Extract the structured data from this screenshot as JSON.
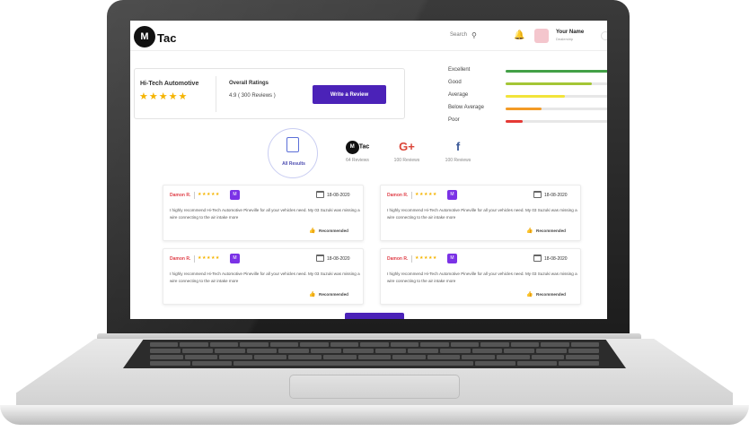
{
  "header": {
    "logo_mark": "M",
    "logo_text": "Tac",
    "search_label": "Search",
    "user_name": "Your Name",
    "user_role": "Dealership"
  },
  "summary": {
    "business_name": "Hi-Tech Automotive",
    "stars": "★★★★★",
    "overall_label": "Overall Ratings",
    "overall_value": "4.9 ( 300 Reviews )",
    "write_review_label": "Write a Review"
  },
  "rating_breakdown": [
    {
      "label": "Excellent",
      "fraction": 0.95,
      "color": "#43a047"
    },
    {
      "label": "Good",
      "fraction": 0.8,
      "color": "#a4c635"
    },
    {
      "label": "Average",
      "fraction": 0.55,
      "color": "#f2e43a"
    },
    {
      "label": "Below Average",
      "fraction": 0.33,
      "color": "#f39a26"
    },
    {
      "label": "Poor",
      "fraction": 0.16,
      "color": "#e53935"
    }
  ],
  "sources": [
    {
      "name": "All Results",
      "count": ""
    },
    {
      "name": "MTac",
      "icon": "mtac-logo-icon",
      "count": "64 Reviews"
    },
    {
      "name": "Google",
      "icon": "google-plus-icon",
      "glyph": "G+",
      "color": "#db4437",
      "count": "100 Reviews"
    },
    {
      "name": "Facebook",
      "icon": "facebook-icon",
      "glyph": "f",
      "color": "#3b5998",
      "count": "100 Reviews"
    }
  ],
  "reviews": [
    {
      "name": "Damon R.",
      "stars": "★★★★★",
      "badge": "M",
      "date": "18-08-2020",
      "text": "I highly recommend Hi-Tech Automotive Pineville for all your vehicles need. My 03 Suzuki was missing a wire connecting to the air intake more",
      "recommended": "Recommended"
    },
    {
      "name": "Damon R.",
      "stars": "★★★★★",
      "badge": "M",
      "date": "18-08-2020",
      "text": "I highly recommend Hi-Tech Automotive Pineville for all your vehicles need. My 03 Suzuki was missing a wire connecting to the air intake more",
      "recommended": "Recommended"
    },
    {
      "name": "Damon R.",
      "stars": "★★★★★",
      "badge": "M",
      "date": "18-08-2020",
      "text": "I highly recommend Hi-Tech Automotive Pineville for all your vehicles need. My 03 Suzuki was missing a wire connecting to the air intake more",
      "recommended": "Recommended"
    },
    {
      "name": "Damon R.",
      "stars": "★★★★★",
      "badge": "M",
      "date": "18-08-2020",
      "text": "I highly recommend Hi-Tech Automotive Pineville for all your vehicles need. My 03 Suzuki was missing a wire connecting to the air intake more",
      "recommended": "Recommended"
    }
  ],
  "colors": {
    "accent": "#4b22b8",
    "star": "#f5b400",
    "reviewer": "#e0424b"
  }
}
